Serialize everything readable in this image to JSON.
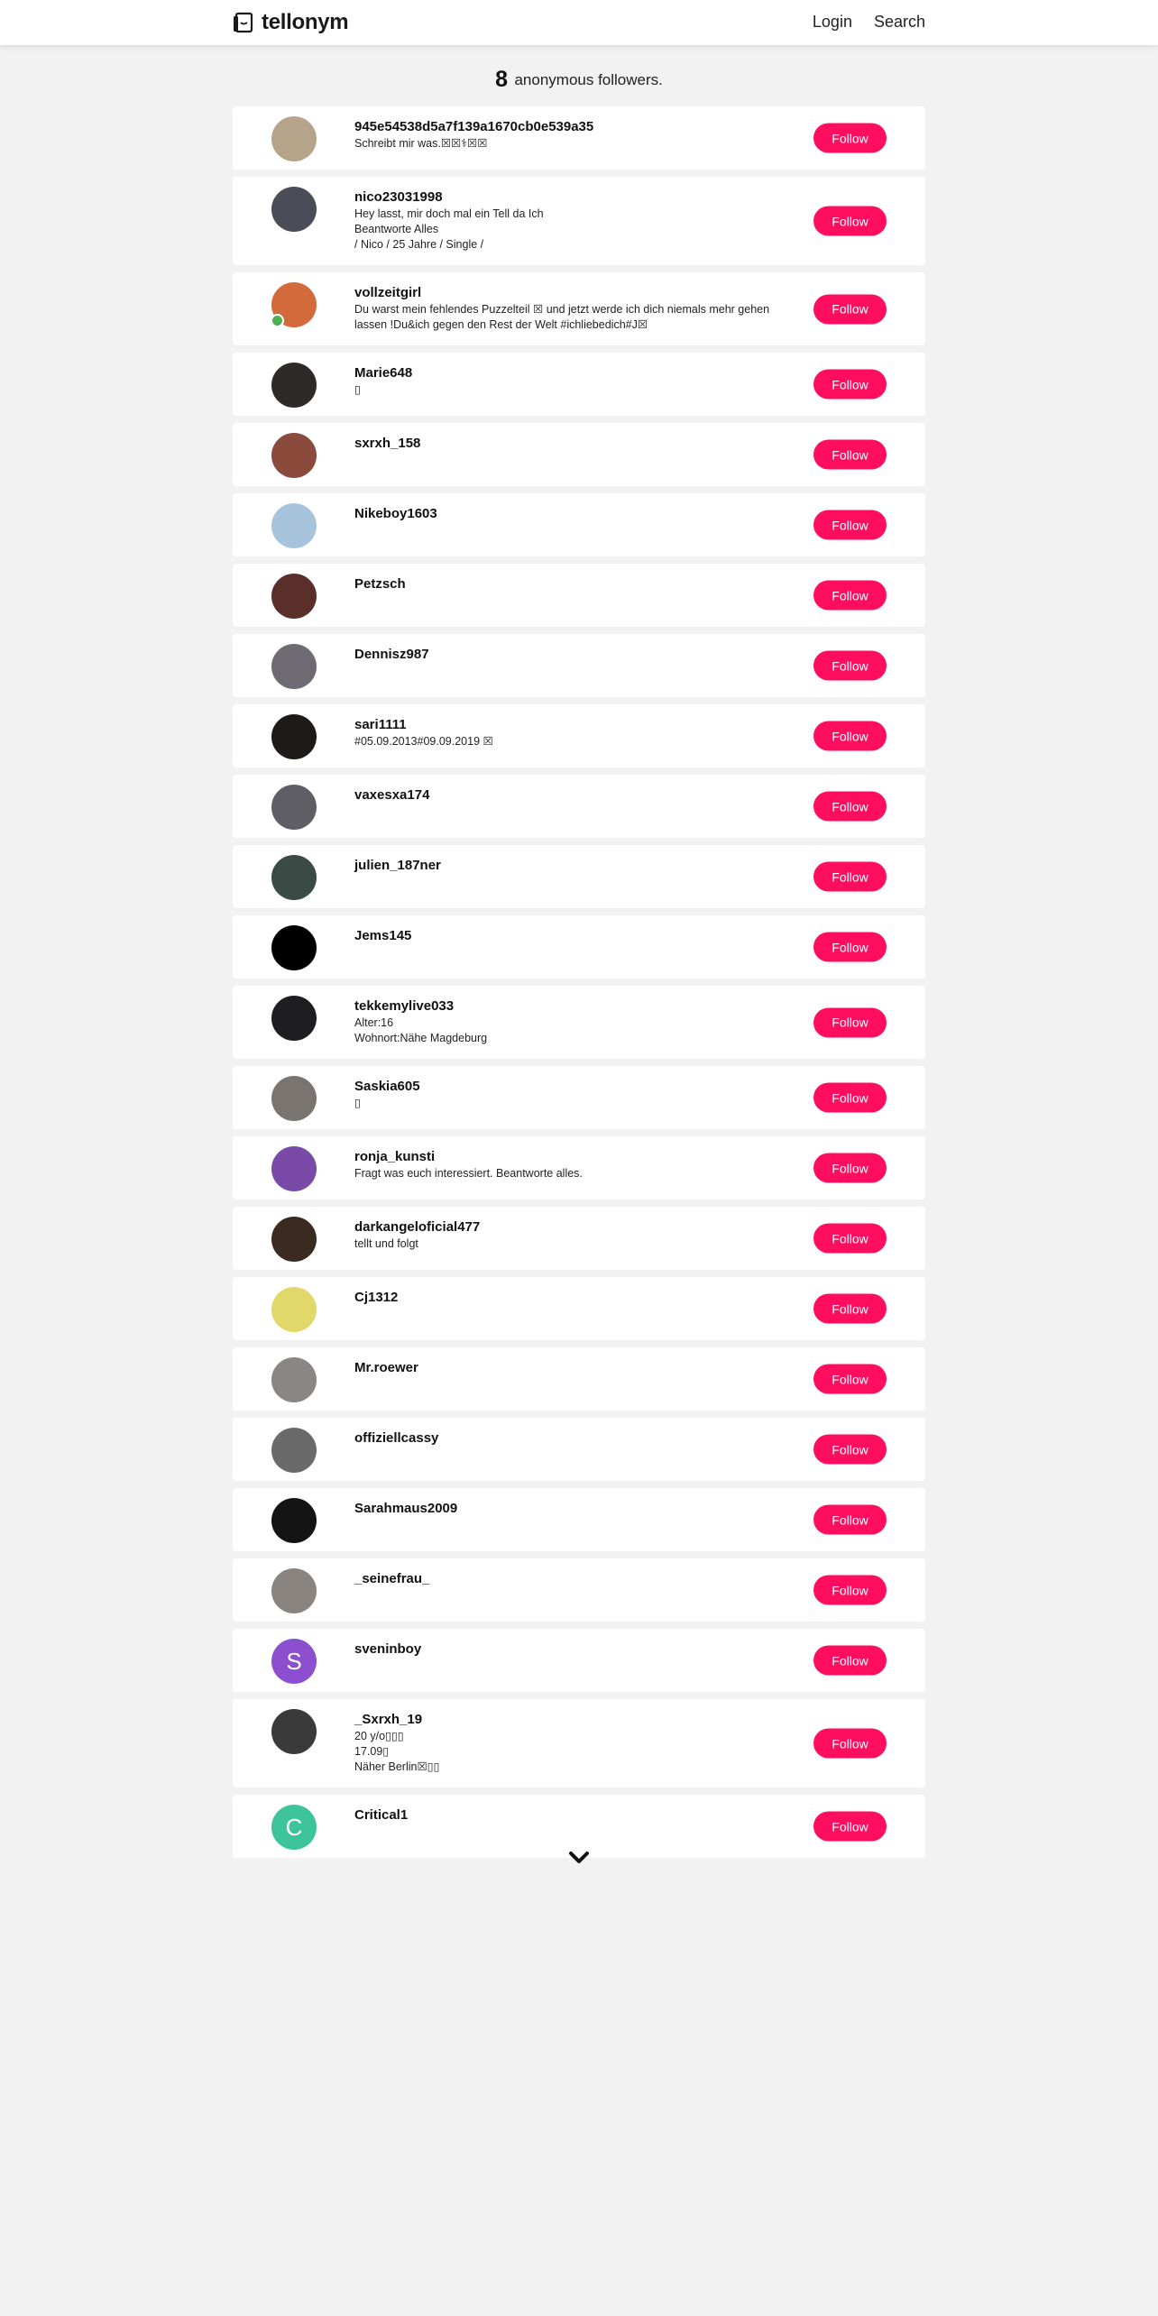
{
  "brand": {
    "name": "tellonym"
  },
  "nav": {
    "login": "Login",
    "search": "Search"
  },
  "headline": {
    "count": "8",
    "text": "anonymous followers."
  },
  "follow_label": "Follow",
  "colors": {
    "accent": "#ff0e60",
    "background": "#f2f2f2",
    "online": "#4caf50"
  },
  "followers": [
    {
      "username": "945e54538d5a7f139a1670cb0e539a35",
      "bio": "Schreibt mir was.☒☒⚕☒☒",
      "avatar_color": "#b5a48a",
      "online": false
    },
    {
      "username": "nico23031998",
      "bio": "Hey lasst, mir doch mal ein Tell da Ich\nBeantworte Alles\n/ Nico / 25 Jahre / Single /",
      "avatar_color": "#4a4d57",
      "online": false
    },
    {
      "username": "vollzeitgirl",
      "bio": "Du warst mein fehlendes Puzzelteil ☒ und jetzt werde ich dich niemals mehr gehen lassen !Du&ich gegen den Rest der Welt #ichliebedich#J☒",
      "avatar_color": "#d36a3c",
      "online": true
    },
    {
      "username": "Marie648",
      "bio": "▯",
      "avatar_color": "#2e2a2a",
      "online": false
    },
    {
      "username": "sxrxh_158",
      "bio": "",
      "avatar_color": "#8a4a3c",
      "online": false
    },
    {
      "username": "Nikeboy1603",
      "bio": "",
      "avatar_color": "#a8c4dc",
      "online": false
    },
    {
      "username": "Petzsch",
      "bio": "",
      "avatar_color": "#5a2e2a",
      "online": false
    },
    {
      "username": "Dennisz987",
      "bio": "",
      "avatar_color": "#6e6a72",
      "online": false
    },
    {
      "username": "sari1111",
      "bio": "#05.09.2013#09.09.2019 ☒",
      "avatar_color": "#1e1a1a",
      "online": false
    },
    {
      "username": "vaxesxa174",
      "bio": "",
      "avatar_color": "#5e5e64",
      "online": false
    },
    {
      "username": "julien_187ner",
      "bio": "",
      "avatar_color": "#3a4a44",
      "online": false
    },
    {
      "username": "Jems145",
      "bio": "",
      "avatar_color": "#000000",
      "online": false
    },
    {
      "username": "tekkemylive033",
      "bio": "Alter:16\nWohnort:Nähe Magdeburg",
      "avatar_color": "#1e1e20",
      "online": false
    },
    {
      "username": "Saskia605",
      "bio": "▯",
      "avatar_color": "#7a7470",
      "online": false
    },
    {
      "username": "ronja_kunsti",
      "bio": "Fragt was euch interessiert. Beantworte alles.",
      "avatar_color": "#7a4aa8",
      "online": false
    },
    {
      "username": "darkangeloficial477",
      "bio": "tellt und folgt",
      "avatar_color": "#3a2a22",
      "online": false
    },
    {
      "username": "Cj1312",
      "bio": "",
      "avatar_color": "#e2d86a",
      "online": false
    },
    {
      "username": "Mr.roewer",
      "bio": "",
      "avatar_color": "#8a8686",
      "online": false
    },
    {
      "username": "offiziellcassy",
      "bio": "",
      "avatar_color": "#6a6a6a",
      "online": false
    },
    {
      "username": "Sarahmaus2009",
      "bio": "",
      "avatar_color": "#141414",
      "online": false
    },
    {
      "username": "_seinefrau_",
      "bio": "",
      "avatar_color": "#8a8480",
      "online": false
    },
    {
      "username": "sveninboy",
      "bio": "",
      "avatar_color": "#8b4fcf",
      "avatar_letter": "S",
      "online": false
    },
    {
      "username": "_Sxrxh_19",
      "bio": "20 y/o▯▯▯\n17.09▯\nNäher Berlin☒▯▯",
      "avatar_color": "#3a3a3a",
      "online": false
    },
    {
      "username": "Critical1",
      "bio": "",
      "avatar_color": "#3ec49a",
      "avatar_letter": "C",
      "online": false
    }
  ]
}
